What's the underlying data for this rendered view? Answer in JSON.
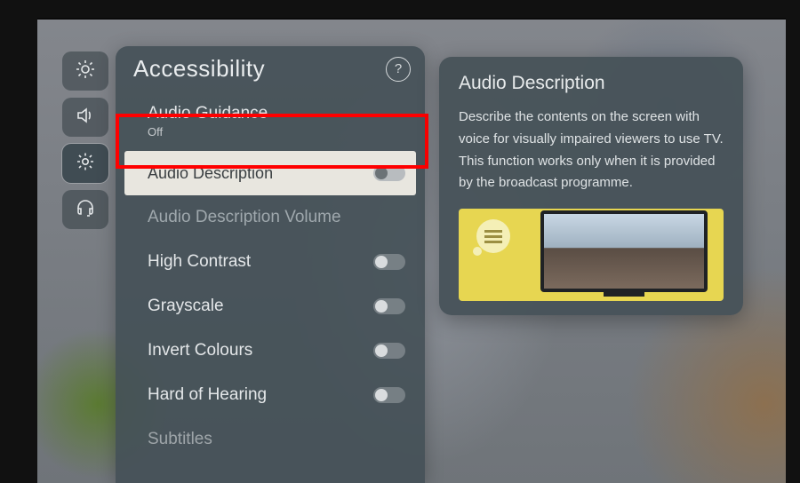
{
  "rail": {
    "items": [
      {
        "name": "picture",
        "icon": "brightness-icon"
      },
      {
        "name": "sound",
        "icon": "speaker-icon"
      },
      {
        "name": "settings",
        "icon": "gear-icon",
        "active": true
      },
      {
        "name": "support",
        "icon": "headset-icon"
      }
    ]
  },
  "panel": {
    "title": "Accessibility",
    "help_label": "?",
    "items": {
      "audio_guidance": {
        "label": "Audio Guidance",
        "value": "Off"
      },
      "audio_description": {
        "label": "Audio Description"
      },
      "ad_volume": {
        "label": "Audio Description Volume"
      },
      "high_contrast": {
        "label": "High Contrast"
      },
      "grayscale": {
        "label": "Grayscale"
      },
      "invert": {
        "label": "Invert Colours"
      },
      "hard_of_hearing": {
        "label": "Hard of Hearing"
      },
      "subtitles": {
        "label": "Subtitles"
      }
    }
  },
  "card": {
    "title": "Audio Description",
    "body": "Describe the contents on the screen with voice for visually impaired viewers to use TV. This function works only when it is provided by the broadcast programme."
  }
}
